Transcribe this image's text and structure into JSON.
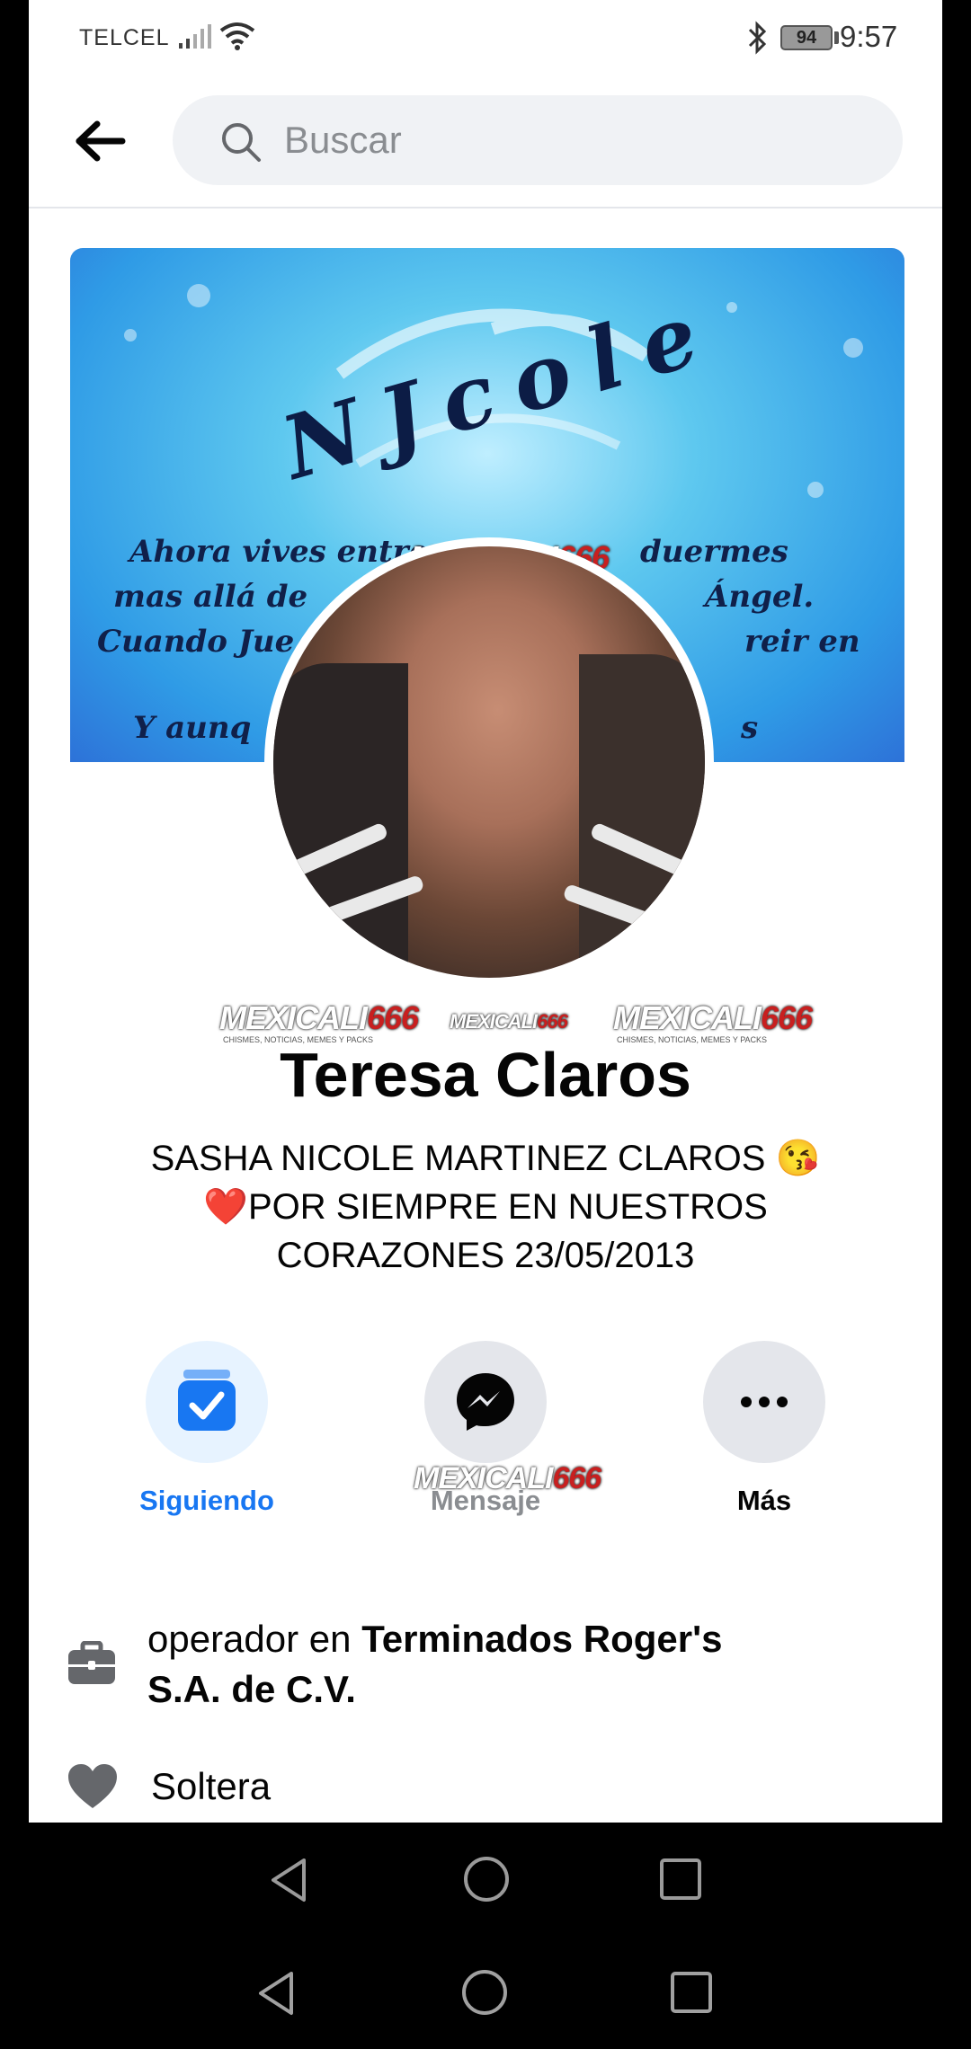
{
  "status_bar": {
    "carrier": "TELCEL",
    "battery": "94",
    "time": "9:57"
  },
  "header": {
    "search_placeholder": "Buscar"
  },
  "cover": {
    "title": "NJcole",
    "lines": [
      "Ahora vives entre",
      "duermes",
      "mas allá de",
      "Ángel.",
      "Cuando Jue",
      "reir en",
      "Y aunq",
      "s"
    ]
  },
  "watermark": {
    "brand_a": "MEXICALI",
    "brand_b": "666",
    "tagline": "CHISMES, NOTICIAS, MEMES Y PACKS"
  },
  "profile": {
    "name": "Teresa Claros",
    "bio_line1": "SASHA NICOLE MARTINEZ CLAROS 😘",
    "bio_line2_heart": "❤️",
    "bio_line2": "POR SIEMPRE EN NUESTROS",
    "bio_line3": "CORAZONES  23/05/2013"
  },
  "actions": [
    {
      "label": "Siguiendo",
      "icon": "following-check-icon",
      "color": "#1877f2"
    },
    {
      "label": "Mensaje",
      "icon": "messenger-icon",
      "color": "#050505"
    },
    {
      "label": "Más",
      "icon": "more-dots-icon",
      "color": "#050505"
    }
  ],
  "info": {
    "work_prefix": "operador en ",
    "work_company_line1": "Terminados Roger's",
    "work_company_line2": "S.A. de C.V.",
    "relationship": "Soltera"
  },
  "colors": {
    "accent": "#1877f2",
    "light_accent": "#e7f3ff",
    "gray_button": "#e4e6eb"
  }
}
